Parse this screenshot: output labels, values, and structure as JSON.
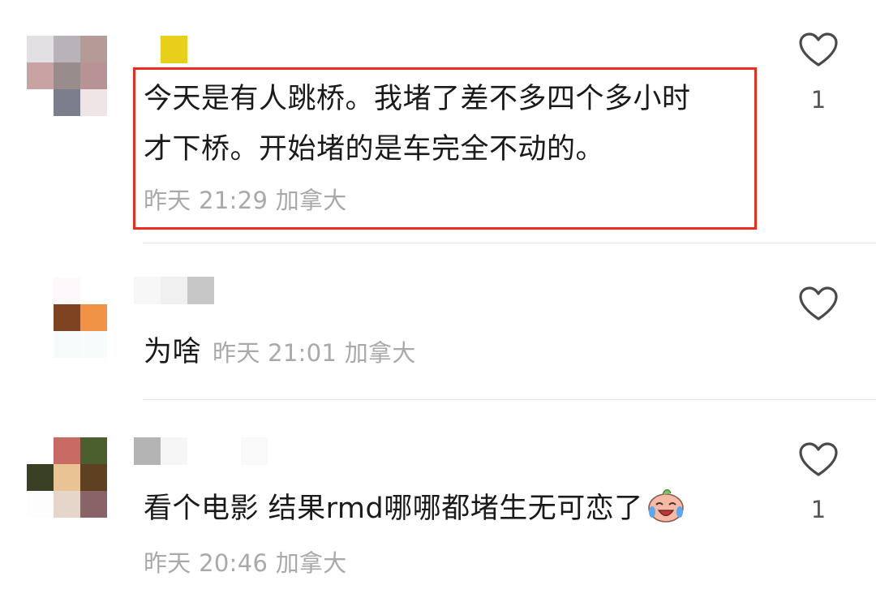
{
  "colors": {
    "highlight_border": "#ee2c1e",
    "meta_text": "#a9a9a9",
    "body_text": "#1a1a1a",
    "divider": "#e6e6e6"
  },
  "comments": [
    {
      "text_line1": "今天是有人跳桥。我堵了差不多四个多小时",
      "text_line2": "才下桥。开始堵的是车完全不动的。",
      "meta": "昨天 21:29 加拿大",
      "like_icon": "heart-outline-icon",
      "likes": "1",
      "highlighted": true
    },
    {
      "text": "为啥",
      "meta": "昨天 21:01 加拿大",
      "like_icon": "heart-outline-icon",
      "likes": ""
    },
    {
      "text": "看个电影 结果rmd哪哪都堵生无可恋了",
      "emoji": "crying-laughing-emoji-icon",
      "meta": "昨天 20:46 加拿大",
      "like_icon": "heart-outline-icon",
      "likes": "1"
    }
  ]
}
